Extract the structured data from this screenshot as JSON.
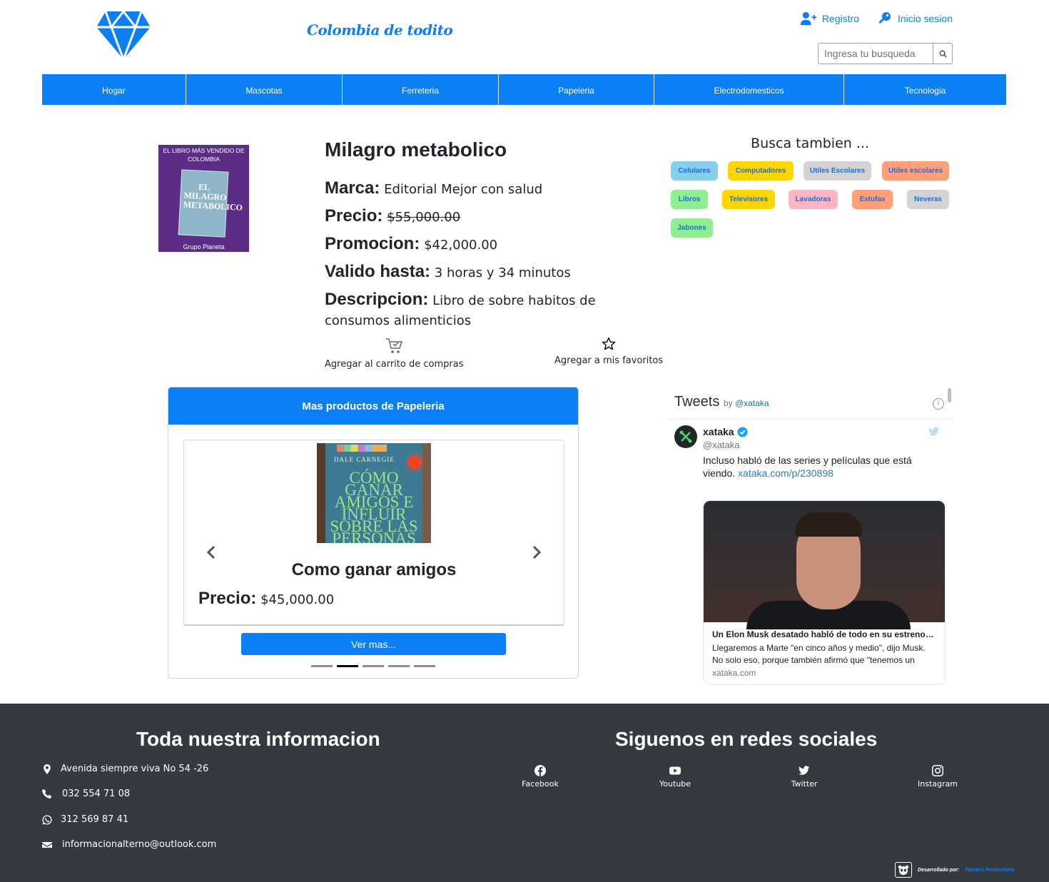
{
  "header": {
    "brand": "Colombia de todito",
    "links": {
      "register": "Registro",
      "login": "Inicio sesion"
    },
    "search": {
      "placeholder": "Ingresa tu busqueda"
    }
  },
  "nav": [
    "Hogar",
    "Mascotas",
    "Ferreteria",
    "Papeleria",
    "Electrodomesticos",
    "Tecnologia"
  ],
  "product": {
    "image": {
      "top_text": "EL LIBRO MÁS VENDIDO DE COLOMBIA",
      "cover_title": "EL MILAGRO METABOLICO",
      "publisher": "Grupo Planeta"
    },
    "title": "Milagro metabolico",
    "marca_label": "Marca:",
    "marca": "Editorial Mejor con salud",
    "precio_label": "Precio:",
    "precio": "$55,000.00",
    "promo_label": "Promocion:",
    "promo": "$42,000.00",
    "valido_label": "Valido hasta:",
    "valido": "3 horas y 34 minutos",
    "desc_label": "Descripcion:",
    "desc": "Libro de sobre habitos de consumos alimenticios",
    "add_cart": "Agregar al carrito de compras",
    "add_fav": "Agregar a mis favoritos"
  },
  "busca": {
    "title": "Busca tambien ...",
    "tags": [
      {
        "label": "Celulares",
        "color": "#87ceeb"
      },
      {
        "label": "Computadores",
        "color": "#ffd700"
      },
      {
        "label": "Utiles Escolares",
        "color": "#d3d3d3"
      },
      {
        "label": "Utiles escolares",
        "color": "#ffa07a"
      },
      {
        "label": "Libros",
        "color": "#90ee90"
      },
      {
        "label": "Televisores",
        "color": "#ffd700"
      },
      {
        "label": "Lavadoras",
        "color": "#ffb6c1"
      },
      {
        "label": "Estufas",
        "color": "#ffa07a"
      },
      {
        "label": "Neveras",
        "color": "#d3d3d3"
      },
      {
        "label": "Jabones",
        "color": "#90ee90"
      }
    ]
  },
  "more": {
    "title": "Mas productos de Papeleria",
    "slide": {
      "image": {
        "author": "DALE CARNEGIE",
        "title": "CÓMO GANAR AMIGOS E INFLUIR SOBRE LAS PERSONAS"
      },
      "name": "Como ganar amigos",
      "price_label": "Precio:",
      "price": "$45,000.00"
    },
    "ver_mas": "Ver mas...",
    "dots_count": 5,
    "active_dot": 1
  },
  "tweets": {
    "title": "Tweets",
    "by": "by",
    "by_handle": "@xataka",
    "info": "i",
    "user": "xataka",
    "handle": "@xataka",
    "text": "Incluso habló de las series y películas que está viendo.",
    "link": "xataka.com/p/230898",
    "card_title": "Un Elon Musk desatado habló de todo en su estreno e…",
    "card_desc": "Llegaremos a Marte \"en cinco años y medio\", dijo Musk. No solo eso, porque también afirmó que \"tenemos un",
    "card_domain": "xataka.com"
  },
  "footer": {
    "info_title": "Toda nuestra informacion",
    "social_title": "Siguenos en redes sociales",
    "address": "Avenida siempre viva No 54 -26",
    "phone": "032 554 71 08",
    "whatsapp": "312 569 87 41",
    "email": "informacionalterno@outlook.com",
    "social": [
      "Facebook",
      "Youtube",
      "Twitter",
      "Instagram"
    ],
    "dev_label": "Desarrollado por:",
    "dev_name": "Panda's Productions"
  },
  "colors": {
    "primary": "#0d7ff5",
    "footer_bg": "#343a40"
  }
}
